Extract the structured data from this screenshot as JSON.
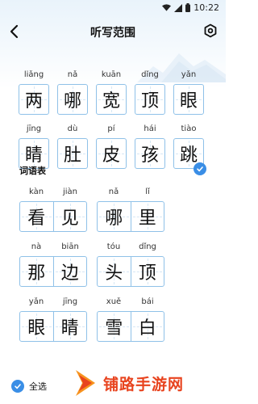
{
  "status_bar": {
    "time": "10:22"
  },
  "nav": {
    "title": "听写范围"
  },
  "chars": [
    {
      "pinyin": "liǎng",
      "char": "两"
    },
    {
      "pinyin": "nǎ",
      "char": "哪"
    },
    {
      "pinyin": "kuān",
      "char": "宽"
    },
    {
      "pinyin": "dǐng",
      "char": "顶"
    },
    {
      "pinyin": "yǎn",
      "char": "眼"
    },
    {
      "pinyin": "jīng",
      "char": "睛"
    },
    {
      "pinyin": "dù",
      "char": "肚"
    },
    {
      "pinyin": "pí",
      "char": "皮"
    },
    {
      "pinyin": "hái",
      "char": "孩"
    },
    {
      "pinyin": "tiào",
      "char": "跳"
    }
  ],
  "words_section": {
    "title": "词语表"
  },
  "words": [
    {
      "pinyin": [
        "kàn",
        "jiàn"
      ],
      "chars": [
        "看",
        "见"
      ]
    },
    {
      "pinyin": [
        "nǎ",
        "lǐ"
      ],
      "chars": [
        "哪",
        "里"
      ]
    },
    {
      "pinyin": [
        "nà",
        "biān"
      ],
      "chars": [
        "那",
        "边"
      ]
    },
    {
      "pinyin": [
        "tóu",
        "dǐng"
      ],
      "chars": [
        "头",
        "顶"
      ]
    },
    {
      "pinyin": [
        "yǎn",
        "jīng"
      ],
      "chars": [
        "眼",
        "睛"
      ]
    },
    {
      "pinyin": [
        "xuě",
        "bái"
      ],
      "chars": [
        "雪",
        "白"
      ]
    }
  ],
  "bottom": {
    "select_all_label": "全选"
  },
  "watermark": {
    "text": "铺路手游网"
  },
  "colors": {
    "accent": "#3a8ee6",
    "grid_border": "#8fc1e8",
    "watermark": "#e8431e"
  },
  "icons": [
    "back-arrow-icon",
    "settings-icon",
    "wifi-icon",
    "signal-icon",
    "battery-icon",
    "check-icon"
  ]
}
